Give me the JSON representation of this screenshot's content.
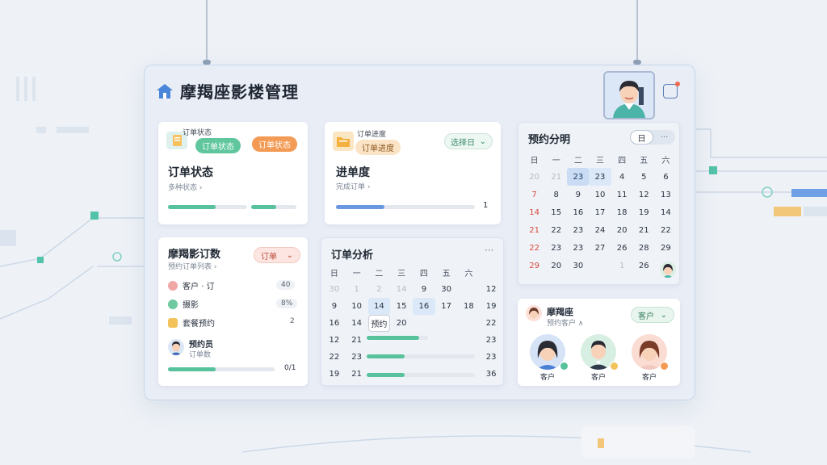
{
  "app": {
    "title": "摩羯座影楼管理"
  },
  "card_status": {
    "tag_label": "订单状态",
    "pill_green": "订单状态",
    "pill_orange": "订单状态",
    "heading": "订单状态",
    "sub": "多种状态 ›",
    "progress": [
      0.6,
      0.55
    ]
  },
  "card_progress": {
    "tag_label": "订单进度",
    "tag_sub": "订单进度",
    "dropdown": "选择日",
    "heading": "进单度",
    "sub": "完成订单 ›",
    "progress": 0.35,
    "count": "1"
  },
  "calendar_right": {
    "title": "预约分明",
    "view_btn": "日",
    "more": "···",
    "weekdays": [
      "日",
      "一",
      "二",
      "三",
      "四",
      "五",
      "六"
    ],
    "rows": [
      [
        "20",
        "21",
        "23",
        "23",
        "4",
        "5",
        "6"
      ],
      [
        "7",
        "8",
        "9",
        "10",
        "11",
        "12",
        "13"
      ],
      [
        "14",
        "15",
        "16",
        "17",
        "18",
        "19",
        "14"
      ],
      [
        "21",
        "22",
        "23",
        "24",
        "20",
        "21",
        "22"
      ],
      [
        "22",
        "23",
        "23",
        "27",
        "26",
        "28",
        "29"
      ],
      [
        "29",
        "20",
        "30",
        "",
        "1",
        "26",
        ""
      ]
    ]
  },
  "card_orders": {
    "title": "摩羯影订数",
    "sub": "预约订单列表 ›",
    "dropdown": "订单",
    "items": [
      {
        "label": "客户 · 订",
        "value": "40"
      },
      {
        "label": "摄影",
        "value": "8%"
      },
      {
        "label": "套餐预约",
        "value": "2"
      }
    ],
    "person_name": "预约员",
    "person_sub": "订单数",
    "progress": 0.45,
    "progress_value": "0/1"
  },
  "calendar_mid": {
    "title": "订单分析",
    "more": "···",
    "weekdays": [
      "日",
      "一",
      "二",
      "三",
      "四",
      "五",
      "六"
    ],
    "rows": [
      [
        "30",
        "1",
        "2",
        "14",
        "9",
        "30",
        "12"
      ],
      [
        "9",
        "10",
        "14",
        "15",
        "16",
        "17",
        "18",
        "19"
      ],
      [
        "16",
        "14",
        "预约",
        "20",
        "",
        "",
        "22"
      ],
      [
        "12",
        "21",
        "",
        "",
        "",
        "",
        "23"
      ],
      [
        "22",
        "23",
        "",
        "",
        "",
        "",
        "23"
      ],
      [
        "19",
        "21",
        "",
        "",
        "",
        "",
        "36"
      ]
    ],
    "bars": [
      0.85,
      0.35,
      0.35
    ]
  },
  "card_clients": {
    "title": "摩羯座",
    "sub": "预约客户 ∧",
    "dropdown": "客户",
    "clients": [
      {
        "label": "客户"
      },
      {
        "label": "客户"
      },
      {
        "label": "客户"
      }
    ]
  },
  "colors": {
    "accent_blue": "#4a7fd6",
    "green": "#4fc39a",
    "orange": "#f2994a",
    "red": "#d9483b"
  }
}
